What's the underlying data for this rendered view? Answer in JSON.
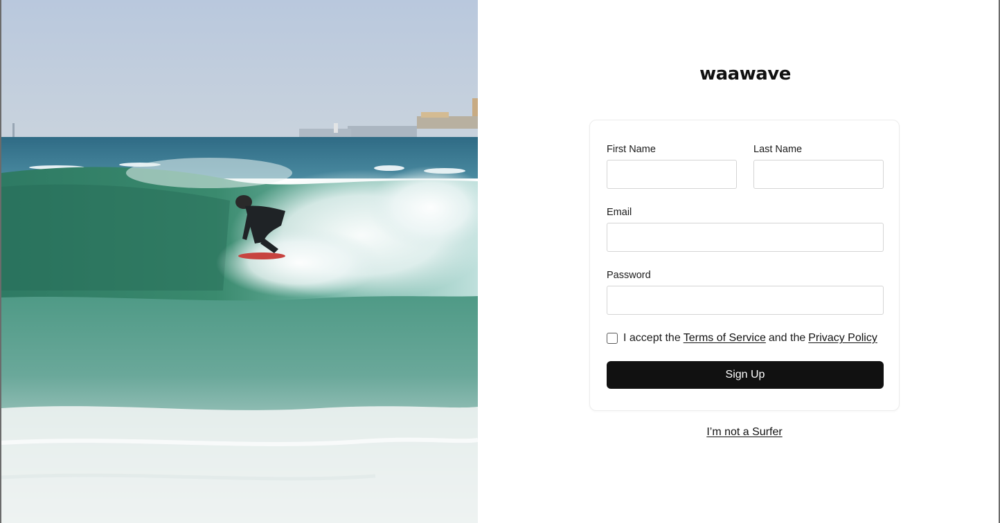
{
  "brand": {
    "logo_text": "waawave"
  },
  "form": {
    "first_name_label": "First Name",
    "first_name_value": "",
    "last_name_label": "Last Name",
    "last_name_value": "",
    "email_label": "Email",
    "email_value": "",
    "password_label": "Password",
    "password_value": "",
    "terms_prefix": "I accept the",
    "terms_link": "Terms of Service",
    "terms_middle": "and the",
    "privacy_link": "Privacy Policy",
    "terms_checked": false,
    "submit_label": "Sign Up"
  },
  "footer": {
    "not_surfer_link": "I’m not a Surfer"
  },
  "colors": {
    "button_bg": "#111111",
    "button_text": "#ffffff",
    "input_border": "#d4d4d4",
    "card_border": "#ececec"
  }
}
